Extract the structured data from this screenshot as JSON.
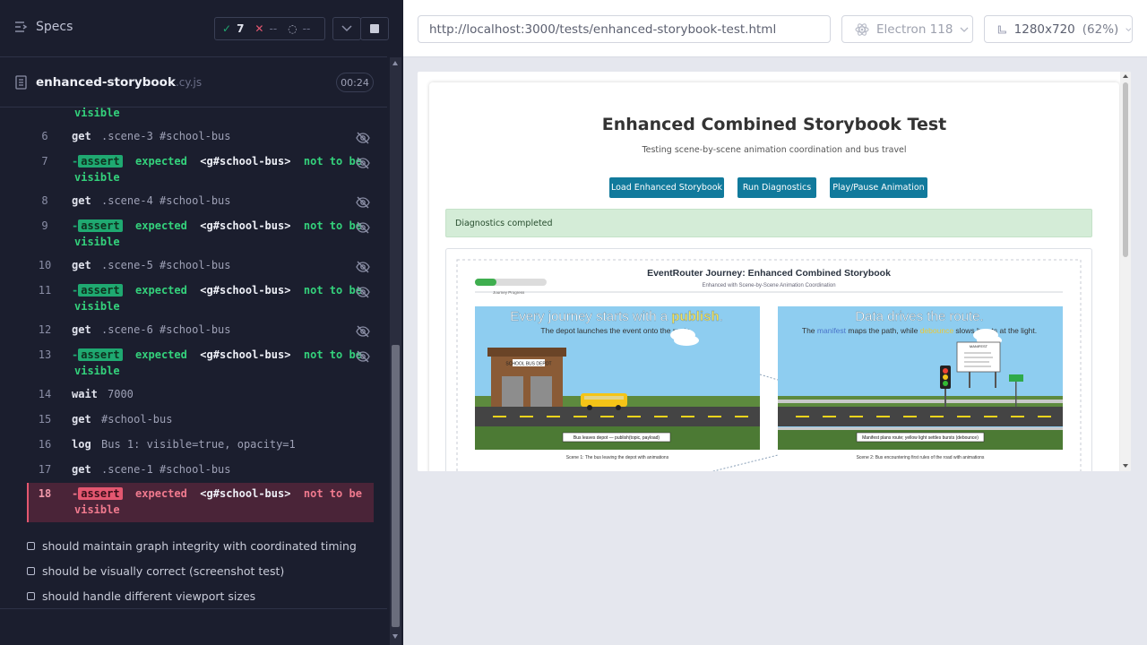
{
  "runner": {
    "specs_label": "Specs",
    "passed": "7",
    "failed": "--",
    "pending": "--",
    "file_name": "enhanced-storybook",
    "file_ext": ".cy.js",
    "duration": "00:24"
  },
  "commands": [
    {
      "num": "",
      "continuation": "visible"
    },
    {
      "num": "6",
      "name": "get",
      "msg": ".scene-3 #school-bus"
    },
    {
      "num": "7",
      "name": "-assert",
      "expected": "expected",
      "selector": "<g#school-bus>",
      "rest": "not to be",
      "cont": "visible"
    },
    {
      "num": "8",
      "name": "get",
      "msg": ".scene-4 #school-bus"
    },
    {
      "num": "9",
      "name": "-assert",
      "expected": "expected",
      "selector": "<g#school-bus>",
      "rest": "not to be",
      "cont": "visible"
    },
    {
      "num": "10",
      "name": "get",
      "msg": ".scene-5 #school-bus"
    },
    {
      "num": "11",
      "name": "-assert",
      "expected": "expected",
      "selector": "<g#school-bus>",
      "rest": "not to be",
      "cont": "visible"
    },
    {
      "num": "12",
      "name": "get",
      "msg": ".scene-6 #school-bus"
    },
    {
      "num": "13",
      "name": "-assert",
      "expected": "expected",
      "selector": "<g#school-bus>",
      "rest": "not to be",
      "cont": "visible"
    },
    {
      "num": "14",
      "name": "wait",
      "msg": "7000"
    },
    {
      "num": "15",
      "name": "get",
      "msg": "#school-bus"
    },
    {
      "num": "16",
      "name": "log",
      "msg": "Bus 1: visible=true, opacity=1"
    },
    {
      "num": "17",
      "name": "get",
      "msg": ".scene-1 #school-bus"
    },
    {
      "num": "18",
      "name": "-assert",
      "expected": "expected",
      "selector": "<g#school-bus>",
      "rest": "not to be",
      "cont": "visible"
    }
  ],
  "tests": [
    "should maintain graph integrity with coordinated timing",
    "should be visually correct (screenshot test)",
    "should handle different viewport sizes"
  ],
  "browser": {
    "url": "http://localhost:3000/tests/enhanced-storybook-test.html",
    "engine": "Electron 118",
    "viewport": "1280x720",
    "scale": "(62%)"
  },
  "page": {
    "title": "Enhanced Combined Storybook Test",
    "subtitle": "Testing scene-by-scene animation coordination and bus travel",
    "buttons": [
      "Load Enhanced Storybook",
      "Run Diagnostics",
      "Play/Pause Animation"
    ],
    "status": "Diagnostics completed",
    "storybook": {
      "title": "EventRouter Journey: Enhanced Combined Storybook",
      "subtitle": "Enhanced with Scene-by-Scene Animation Coordination",
      "progress_label": "Journey Progress",
      "progress": 0.3,
      "scene1": {
        "heading_a": "Every journey starts with a ",
        "heading_b": "publish",
        "heading_c": ".",
        "line": "The depot launches the event onto the route.",
        "depot_sign": "SCHOOL BUS DEPOT",
        "caption": "Bus leaves depot — publish(topic, payload)",
        "label": "Scene 1: The bus leaving the depot with animations"
      },
      "scene2": {
        "heading": "Data drives the route.",
        "line_a": "The ",
        "line_b": "manifest",
        "line_c": " maps the path, while ",
        "line_d": "debounce",
        "line_e": " slows bursts at the light.",
        "board_title": "MANIFEST",
        "caption": "Manifest plans route; yellow light settles bursts (debounce)",
        "label": "Scene 2: Bus encountering first rules of the road with animations"
      }
    }
  },
  "colors": {
    "accent": "#117a9c",
    "pass": "#1fa971",
    "fail": "#e45770",
    "highlight": "#f1e15a"
  }
}
